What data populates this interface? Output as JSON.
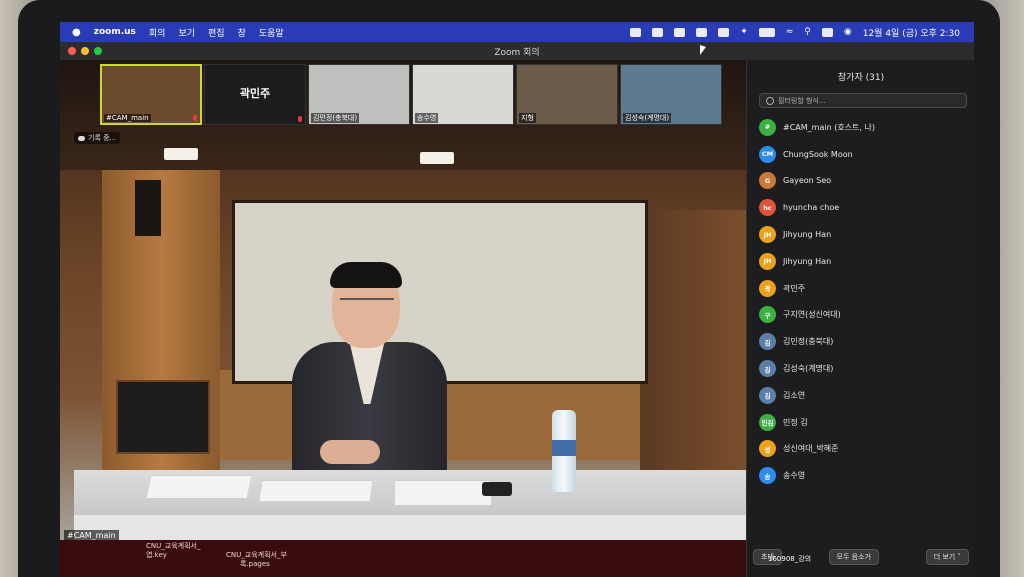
{
  "menubar": {
    "app": "zoom.us",
    "menus": [
      "회의",
      "보기",
      "편집",
      "창",
      "도움말"
    ],
    "clock": "12월 4일 (금) 오후 2:30"
  },
  "window": {
    "title": "Zoom 회의"
  },
  "thumbnails": [
    {
      "label": "#CAM_main",
      "bg": "#6b4a2e"
    },
    {
      "label": "",
      "center": "곽민주",
      "bg": "#1c1c1c"
    },
    {
      "label": "김민정(충북대)",
      "bg": "#bfc0bd"
    },
    {
      "label": "송수영",
      "bg": "#d8d8d4"
    },
    {
      "label": "지형",
      "bg": "#6e5c4a"
    },
    {
      "label": "김성숙(계명대)",
      "bg": "#5d7a8f"
    }
  ],
  "recording": {
    "label": "기록 중..."
  },
  "main_video": {
    "label": "#CAM_main"
  },
  "desktop_files": [
    {
      "text": "CNU_교육계획서_"
    },
    {
      "text": "엽.key"
    },
    {
      "text": "CNU_교육계획서_부"
    },
    {
      "text": "록.pages"
    },
    {
      "text": "160908_강의"
    }
  ],
  "participants": {
    "title": "참가자 (31)",
    "search_placeholder": "필터링할 형식...",
    "list": [
      {
        "initial": "#",
        "name": "#CAM_main (호스트, 나)",
        "color": "#3cb043"
      },
      {
        "initial": "CM",
        "name": "ChungSook Moon",
        "color": "#2d8cf0"
      },
      {
        "initial": "G",
        "name": "Gayeon Seo",
        "color": "#c97a3a"
      },
      {
        "initial": "hc",
        "name": "hyuncha choe",
        "color": "#e0553a"
      },
      {
        "initial": "JH",
        "name": "Jihyung Han",
        "color": "#e9a21a"
      },
      {
        "initial": "JH",
        "name": "Jihyung Han",
        "color": "#e9a21a"
      },
      {
        "initial": "곽",
        "name": "곽민주",
        "color": "#e9a21a"
      },
      {
        "initial": "구",
        "name": "구지연(성신여대)",
        "color": "#3cb043"
      },
      {
        "initial": "김",
        "name": "김민정(충북대)",
        "color": "#5a7fa8"
      },
      {
        "initial": "김",
        "name": "김성숙(계명대)",
        "color": "#5a7fa8"
      },
      {
        "initial": "김",
        "name": "김소연",
        "color": "#5a7fa8"
      },
      {
        "initial": "민김",
        "name": "민정 김",
        "color": "#3cb043"
      },
      {
        "initial": "성",
        "name": "성신여대_박혜준",
        "color": "#e9a21a"
      },
      {
        "initial": "송",
        "name": "송수영",
        "color": "#2d8cf0"
      }
    ],
    "buttons": {
      "invite": "초대",
      "mute_all": "모두 음소거",
      "more": "더 보기"
    }
  }
}
